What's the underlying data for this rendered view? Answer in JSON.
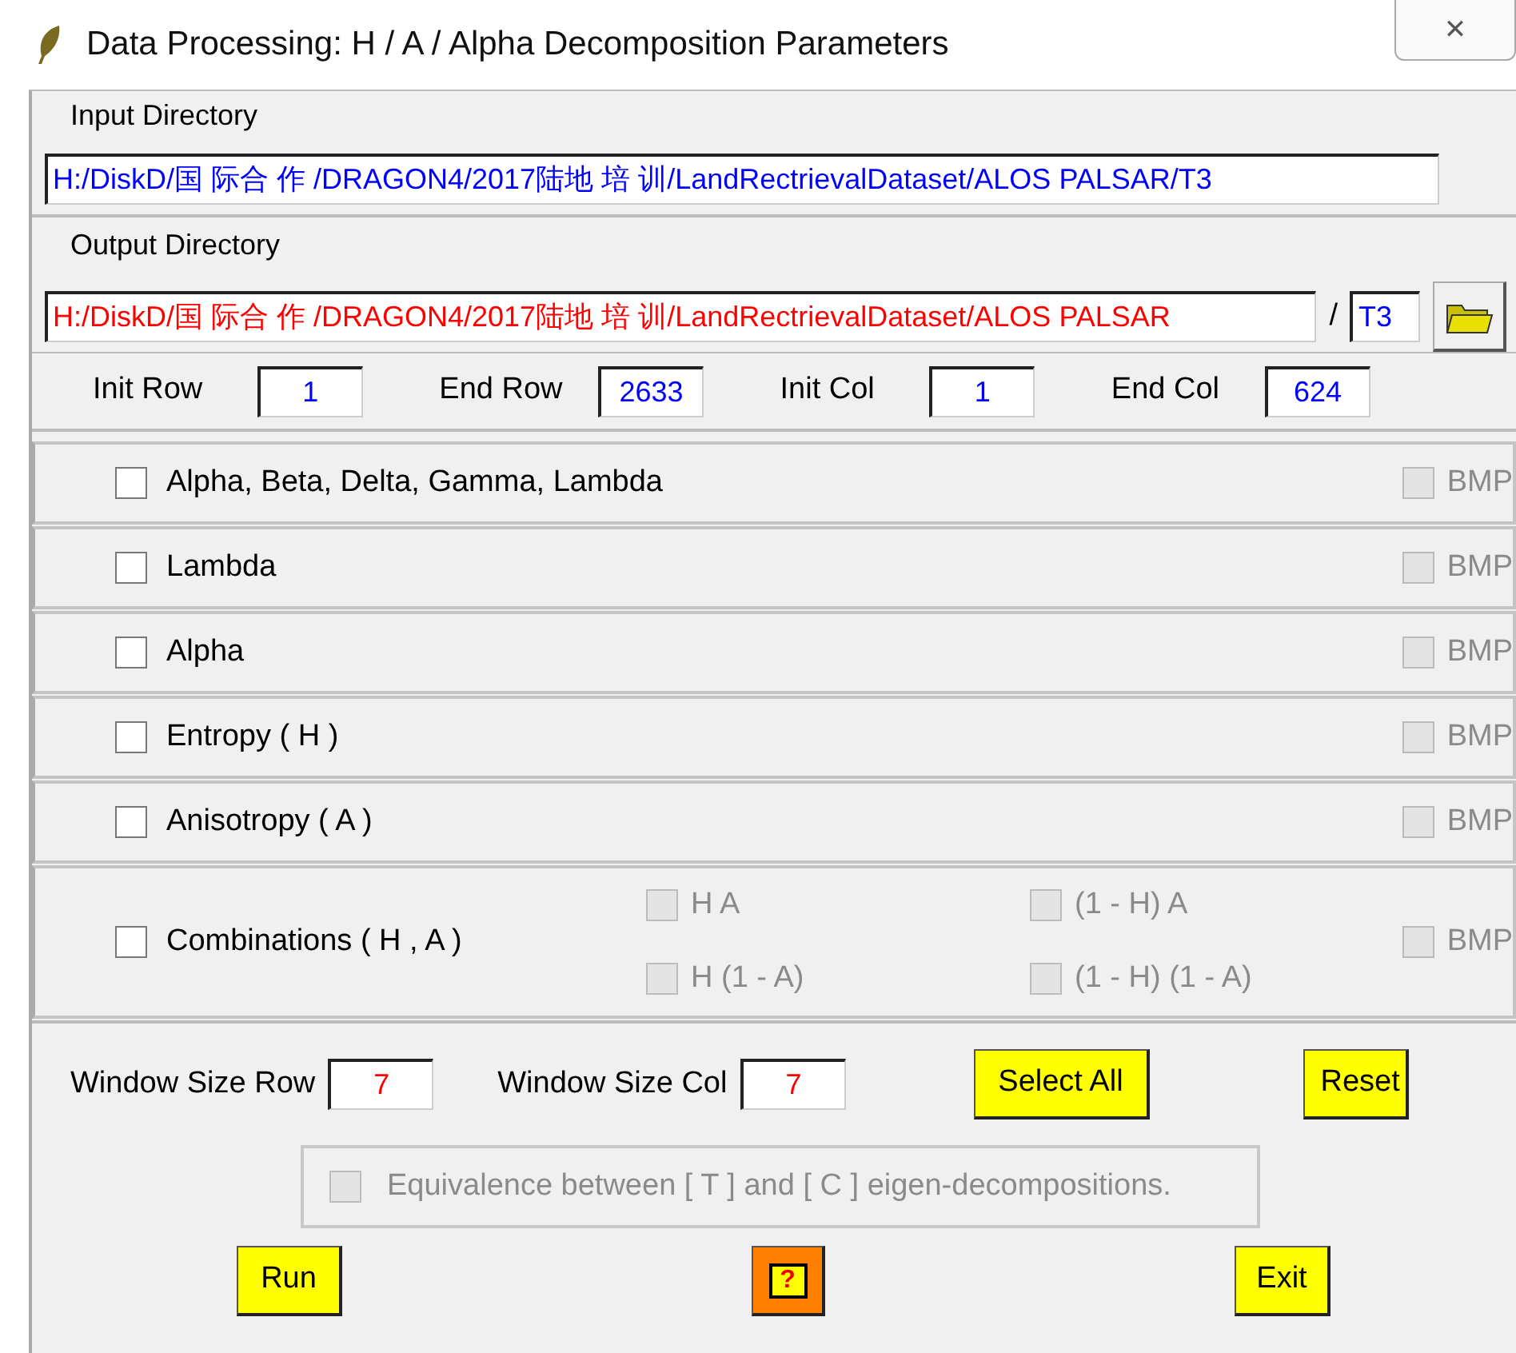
{
  "window": {
    "title": "Data Processing: H / A / Alpha Decomposition Parameters",
    "close": "✕"
  },
  "input_directory": {
    "label": "Input Directory",
    "value": "H:/DiskD/国 际合 作 /DRAGON4/2017陆地 培 训/LandRectrievalDataset/ALOS PALSAR/T3"
  },
  "output_directory": {
    "label": "Output Directory",
    "value": "H:/DiskD/国 际合 作 /DRAGON4/2017陆地 培 训/LandRectrievalDataset/ALOS PALSAR",
    "separator": "/",
    "subdir": "T3"
  },
  "range": [
    {
      "label": "Init Row",
      "value": "1"
    },
    {
      "label": "End Row",
      "value": "2633"
    },
    {
      "label": "Init Col",
      "value": "1"
    },
    {
      "label": "End Col",
      "value": "624"
    }
  ],
  "options": [
    {
      "label": "Alpha, Beta, Delta, Gamma, Lambda",
      "checked": false,
      "bmp": {
        "label": "BMP",
        "checked": false,
        "disabled": true
      }
    },
    {
      "label": "Lambda",
      "checked": false,
      "bmp": {
        "label": "BMP",
        "checked": false,
        "disabled": true
      }
    },
    {
      "label": "Alpha",
      "checked": false,
      "bmp": {
        "label": "BMP",
        "checked": false,
        "disabled": true
      }
    },
    {
      "label": "Entropy ( H )",
      "checked": false,
      "bmp": {
        "label": "BMP",
        "checked": false,
        "disabled": true
      }
    },
    {
      "label": "Anisotropy  ( A )",
      "checked": false,
      "bmp": {
        "label": "BMP",
        "checked": false,
        "disabled": true
      }
    }
  ],
  "combinations": {
    "label": "Combinations ( H , A )",
    "checked": false,
    "items": [
      {
        "label": "H A",
        "checked": false,
        "disabled": true
      },
      {
        "label": "(1 - H) A",
        "checked": false,
        "disabled": true
      },
      {
        "label": "H (1 - A)",
        "checked": false,
        "disabled": true
      },
      {
        "label": "(1 - H) (1 - A)",
        "checked": false,
        "disabled": true
      }
    ],
    "bmp": {
      "label": "BMP",
      "checked": false,
      "disabled": true
    }
  },
  "window_size": [
    {
      "label": "Window Size Row",
      "value": "7"
    },
    {
      "label": "Window Size Col",
      "value": "7"
    }
  ],
  "select_all": "Select All",
  "reset": "Reset",
  "equivalence": {
    "label": "Equivalence between [ T ]  and  [ C ] eigen-decompositions.",
    "checked": false,
    "disabled": true
  },
  "buttons": {
    "run": "Run",
    "help": "?",
    "exit": "Exit"
  }
}
